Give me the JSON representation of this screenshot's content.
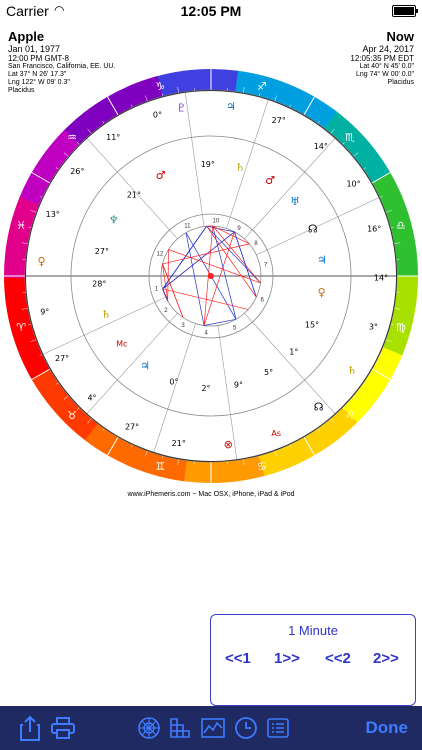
{
  "status": {
    "carrier": "Carrier",
    "time": "12:05 PM"
  },
  "natal": {
    "name": "Apple",
    "date": "Jan 01, 1977",
    "time": "12:00 PM GMT-8",
    "place": "San Francisco, California, EE. UU.",
    "lat": "Lat 37° N 26' 17.3\"",
    "lng": "Lng 122° W 09' 0.3\"",
    "system": "Placidus"
  },
  "transit": {
    "name": "Now",
    "date": "Apr 24, 2017",
    "time": "12:05:35 PM EDT",
    "lat": "Lat 40° N 45' 0.0\"",
    "lng": "Lng 74° W 00' 0.0\"",
    "system": "Placidus"
  },
  "chart": {
    "zodiac_colors": [
      "#ff0000",
      "#ff3a00",
      "#ff6a00",
      "#ff9a00",
      "#ffd000",
      "#ffff00",
      "#a8e000",
      "#2ec02e",
      "#00b0a0",
      "#00a0e0",
      "#4040e0",
      "#8000c0",
      "#c000c0",
      "#e0008a"
    ],
    "zodiac_glyphs": [
      "♈",
      "♉",
      "♊",
      "♋",
      "♌",
      "♍",
      "♎",
      "♏",
      "♐",
      "♑",
      "♒",
      "♓"
    ],
    "outer_labels": [
      {
        "text": "♇",
        "color": "#8a2be2"
      },
      {
        "text": "19°",
        "color": "#000"
      },
      {
        "text": "♃",
        "color": "#0070c0"
      },
      {
        "text": "♄",
        "color": "#c0a000"
      },
      {
        "text": "27°",
        "color": "#000"
      },
      {
        "text": "♂",
        "color": "#cc0000"
      },
      {
        "text": "14°",
        "color": "#000"
      },
      {
        "text": "♅",
        "color": "#0070c0"
      },
      {
        "text": "10°",
        "color": "#000"
      },
      {
        "text": "☊",
        "color": "#000"
      },
      {
        "text": "16°",
        "color": "#000"
      },
      {
        "text": "♃",
        "color": "#0070c0"
      },
      {
        "text": "14°",
        "color": "#000"
      },
      {
        "text": "♀",
        "color": "#cc6600"
      },
      {
        "text": "3°",
        "color": "#000"
      },
      {
        "text": "15°",
        "color": "#000"
      },
      {
        "text": "♄",
        "color": "#c0a000"
      },
      {
        "text": "1°",
        "color": "#000"
      },
      {
        "text": "☊",
        "color": "#000"
      },
      {
        "text": "5°",
        "color": "#000"
      },
      {
        "text": "As",
        "color": "#cc0000"
      },
      {
        "text": "9°",
        "color": "#000"
      },
      {
        "text": "⊗",
        "color": "#cc0000"
      },
      {
        "text": "2°",
        "color": "#000"
      },
      {
        "text": "21°",
        "color": "#000"
      },
      {
        "text": "0°",
        "color": "#000"
      },
      {
        "text": "27°",
        "color": "#000"
      },
      {
        "text": "♃",
        "color": "#0070c0"
      },
      {
        "text": "4°",
        "color": "#000"
      },
      {
        "text": "Mc",
        "color": "#cc0000"
      },
      {
        "text": "27°",
        "color": "#000"
      },
      {
        "text": "♄",
        "color": "#c0a000"
      },
      {
        "text": "9°",
        "color": "#000"
      },
      {
        "text": "28°",
        "color": "#000"
      },
      {
        "text": "♀",
        "color": "#cc6600"
      },
      {
        "text": "27°",
        "color": "#000"
      },
      {
        "text": "13°",
        "color": "#000"
      },
      {
        "text": "♆",
        "color": "#2f8f8f"
      },
      {
        "text": "26°",
        "color": "#000"
      },
      {
        "text": "21°",
        "color": "#000"
      },
      {
        "text": "11°",
        "color": "#000"
      },
      {
        "text": "♂",
        "color": "#cc0000"
      },
      {
        "text": "0°",
        "color": "#000"
      }
    ],
    "house_numbers": [
      "1",
      "2",
      "3",
      "4",
      "5",
      "6",
      "7",
      "8",
      "9",
      "10",
      "11",
      "12"
    ],
    "aspect_colors": [
      "#ff2020",
      "#2030d0"
    ]
  },
  "footer": "www.iPhemeris.com ~ Mac OSX, iPhone, iPad & iPod",
  "stepper": {
    "title": "1 Minute",
    "back1": "<<1",
    "fwd1": "1>>",
    "back2": "<<2",
    "fwd2": "2>>"
  },
  "toolbar": {
    "done": "Done"
  }
}
